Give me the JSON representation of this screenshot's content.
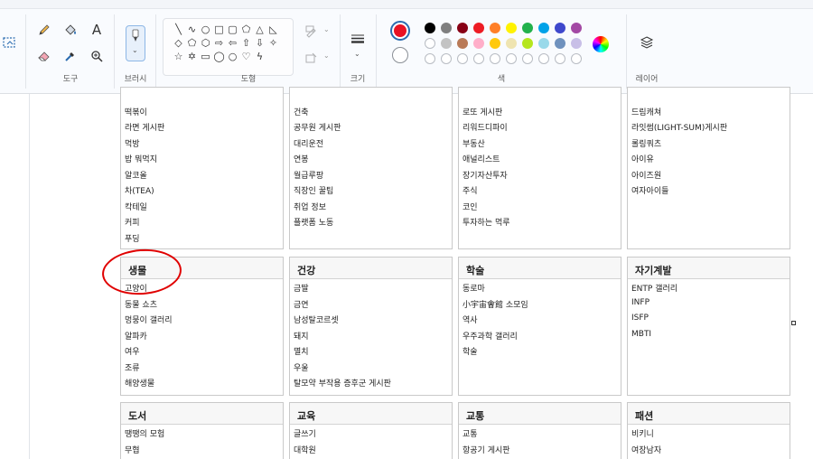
{
  "ribbon": {
    "groups": {
      "tools": "도구",
      "brushes": "브러시",
      "shapes": "도형",
      "size": "크기",
      "colors": "색",
      "layers": "레이어"
    },
    "primary_color": "#e81123",
    "secondary_color": "#ffffff",
    "palette_row1": [
      "#000000",
      "#7f7f7f",
      "#880015",
      "#ed1c24",
      "#ff7f27",
      "#fff200",
      "#22b14c",
      "#00a2e8",
      "#3f48cc",
      "#a349a4"
    ],
    "palette_row2": [
      "#ffffff",
      "#c3c3c3",
      "#b97a57",
      "#ffaec9",
      "#ffc90e",
      "#efe4b0",
      "#b5e61d",
      "#99d9ea",
      "#7092be",
      "#c8bfe7"
    ]
  },
  "board": {
    "top_row": [
      {
        "items": [
          "떡볶이",
          "라면 게시판",
          "먹방",
          "밥 뭐먹지",
          "알코올",
          "차(TEA)",
          "칵테일",
          "커피",
          "푸딩"
        ]
      },
      {
        "items": [
          "건축",
          "공무원 게시판",
          "대리운전",
          "연봉",
          "월급루팡",
          "직장인 꿀팁",
          "취업 정보",
          "플랫폼 노동"
        ]
      },
      {
        "items": [
          "로또 게시판",
          "리워드디파이",
          "부동산",
          "애널리스트",
          "장기자산투자",
          "주식",
          "코인",
          "투자하는 먹루"
        ]
      },
      {
        "items": [
          "드림캐쳐",
          "라잇썸(LIGHT-SUM)게시판",
          "롤링쿼츠",
          "아이유",
          "아이즈원",
          "여자아이들"
        ]
      }
    ],
    "mid_row": [
      {
        "title": "생물",
        "items": [
          "고양이",
          "동물 쇼츠",
          "멍뭉이 갤러리",
          "알파카",
          "여우",
          "조류",
          "해양생물"
        ]
      },
      {
        "title": "건강",
        "items": [
          "금딸",
          "금연",
          "남성탈코르셋",
          "돼지",
          "멸치",
          "우울",
          "탈모약 부작용 증후군 게시판"
        ]
      },
      {
        "title": "학술",
        "items": [
          "동로마",
          "小宇宙會館 소모임",
          "역사",
          "우주과학 갤러리",
          "학술"
        ]
      },
      {
        "title": "자기계발",
        "items": [
          "ENTP 갤러리",
          "INFP",
          "ISFP",
          "MBTI"
        ]
      }
    ],
    "bottom_row": [
      {
        "title": "도서",
        "items": [
          "땡땡의 모험",
          "무협"
        ]
      },
      {
        "title": "교육",
        "items": [
          "글쓰기",
          "대학원"
        ]
      },
      {
        "title": "교통",
        "items": [
          "교통",
          "항공기 게시판"
        ]
      },
      {
        "title": "패션",
        "items": [
          "비키니",
          "여장남자"
        ]
      }
    ]
  }
}
